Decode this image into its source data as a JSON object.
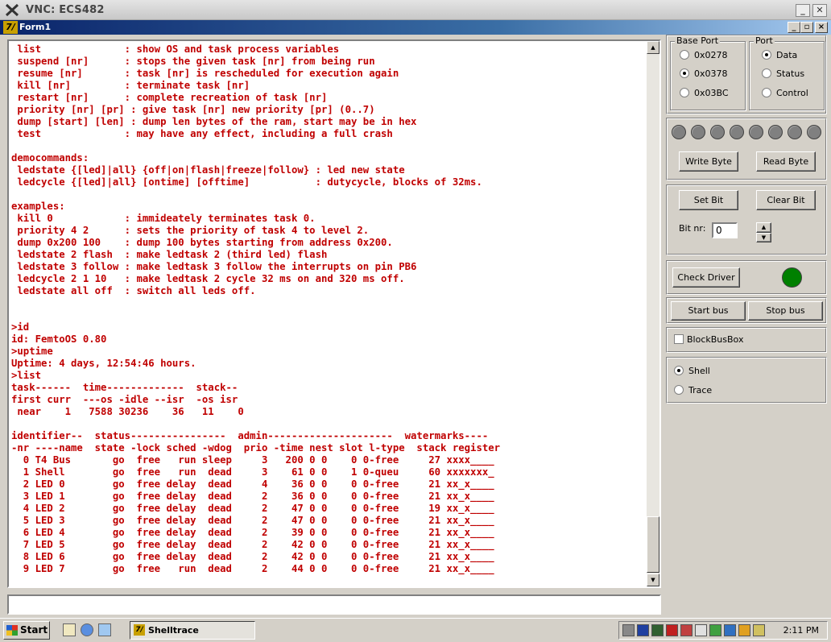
{
  "window": {
    "vnc_title": "VNC: ECS482",
    "form_title": "Form1"
  },
  "terminal": {
    "lines": [
      " list              : show OS and task process variables",
      " suspend [nr]      : stops the given task [nr] from being run",
      " resume [nr]       : task [nr] is rescheduled for execution again",
      " kill [nr]         : terminate task [nr]",
      " restart [nr]      : complete recreation of task [nr]",
      " priority [nr] [pr] : give task [nr] new priority [pr] (0..7)",
      " dump [start] [len] : dump len bytes of the ram, start may be in hex",
      " test              : may have any effect, including a full crash",
      "",
      "democommands:",
      " ledstate {[led]|all} {off|on|flash|freeze|follow} : led new state",
      " ledcycle {[led]|all} [ontime] [offtime]           : dutycycle, blocks of 32ms.",
      "",
      "examples:",
      " kill 0            : immideately terminates task 0.",
      " priority 4 2      : sets the priority of task 4 to level 2.",
      " dump 0x200 100    : dump 100 bytes starting from address 0x200.",
      " ledstate 2 flash  : make ledtask 2 (third led) flash",
      " ledstate 3 follow : make ledtask 3 follow the interrupts on pin PB6",
      " ledcycle 2 1 10   : make ledtask 2 cycle 32 ms on and 320 ms off.",
      " ledstate all off  : switch all leds off.",
      "",
      "",
      ">id",
      "id: FemtoOS 0.80",
      ">uptime",
      "Uptime: 4 days, 12:54:46 hours.",
      ">list",
      "task------  time-------------  stack--",
      "first curr  ---os -idle --isr  -os isr",
      " near    1   7588 30236    36   11    0",
      "",
      "identifier--  status----------------  admin---------------------  watermarks----",
      "-nr ----name  state -lock sched -wdog  prio -time nest slot l-type  stack register",
      "  0 T4 Bus       go  free   run sleep     3   200 0 0    0 0-free     27 xxxx____",
      "  1 Shell        go  free   run  dead     3    61 0 0    1 0-queu     60 xxxxxxx_",
      "  2 LED 0        go  free delay  dead     4    36 0 0    0 0-free     21 xx_x____",
      "  3 LED 1        go  free delay  dead     2    36 0 0    0 0-free     21 xx_x____",
      "  4 LED 2        go  free delay  dead     2    47 0 0    0 0-free     19 xx_x____",
      "  5 LED 3        go  free delay  dead     2    47 0 0    0 0-free     21 xx_x____",
      "  6 LED 4        go  free delay  dead     2    39 0 0    0 0-free     21 xx_x____",
      "  7 LED 5        go  free delay  dead     2    42 0 0    0 0-free     21 xx_x____",
      "  8 LED 6        go  free delay  dead     2    42 0 0    0 0-free     21 xx_x____",
      "  9 LED 7        go  free   run  dead     2    44 0 0    0 0-free     21 xx_x____"
    ],
    "input_value": ""
  },
  "base_port": {
    "label": "Base Port",
    "options": [
      "0x0278",
      "0x0378",
      "0x03BC"
    ],
    "selected": "0x0378"
  },
  "port": {
    "label": "Port",
    "options": [
      "Data",
      "Status",
      "Control"
    ],
    "selected": "Data"
  },
  "byte_panel": {
    "led_count": 8,
    "write_label": "Write Byte",
    "read_label": "Read Byte"
  },
  "bit_panel": {
    "set_label": "Set Bit",
    "clear_label": "Clear Bit",
    "bitnr_label": "Bit nr:",
    "bitnr_value": "0"
  },
  "driver": {
    "check_label": "Check Driver",
    "status_color": "#008000"
  },
  "bus": {
    "start_label": "Start bus",
    "stop_label": "Stop bus"
  },
  "blockbus": {
    "label": "BlockBusBox",
    "checked": false
  },
  "mode": {
    "options": [
      "Shell",
      "Trace"
    ],
    "selected": "Shell"
  },
  "taskbar": {
    "start_label": "Start",
    "task_label": "Shelltrace",
    "clock": "2:11 PM"
  },
  "colors": {
    "terminal_text": "#c00000",
    "title_gradient_start": "#0a246a"
  }
}
